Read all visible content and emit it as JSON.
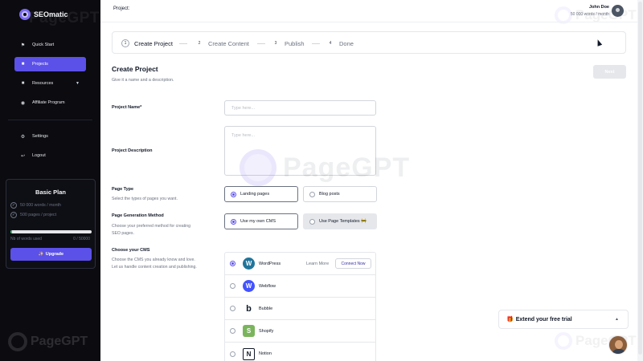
{
  "brand": {
    "name": "SEOmatic",
    "watermark": "PageGPT"
  },
  "sidebar": {
    "items": [
      {
        "label": "Quick Start",
        "icon": "flag-icon"
      },
      {
        "label": "Projects",
        "icon": "file-icon"
      },
      {
        "label": "Resources",
        "icon": "file-icon"
      },
      {
        "label": "Affiliate Program",
        "icon": "bullseye-icon"
      },
      {
        "label": "Settings",
        "icon": "gear-icon"
      },
      {
        "label": "Logout",
        "icon": "logout-icon"
      }
    ],
    "active_item": "Projects"
  },
  "plan": {
    "title": "Basic Plan",
    "features": [
      "50 000 words / month",
      "500 pages / project"
    ],
    "usage_label": "Nb of words used",
    "usage_value": "0 / 50000",
    "usage_fraction": 0.02,
    "upgrade_label": "Upgrade"
  },
  "header": {
    "project_label": "Project:",
    "user_name": "John Doe",
    "user_usage": "50 000 words / month"
  },
  "stepper": {
    "steps": [
      {
        "num": "1",
        "label": "Create Project",
        "active": true
      },
      {
        "num": "2",
        "label": "Create Content",
        "active": false
      },
      {
        "num": "3",
        "label": "Publish",
        "active": false
      },
      {
        "num": "4",
        "label": "Done",
        "active": false
      }
    ]
  },
  "form": {
    "title": "Create Project",
    "subtitle": "Give it a name and a description.",
    "next_label": "Next",
    "project_name_label": "Project Name*",
    "project_name_placeholder": "Type here...",
    "project_name_value": "",
    "project_description_label": "Project Description",
    "project_description_placeholder": "Type here...",
    "page_type": {
      "label": "Page Type",
      "help": "Select the types of pages you want.",
      "options": [
        "Landing pages",
        "Blog posts"
      ],
      "selected": "Landing pages"
    },
    "generation_method": {
      "label": "Page Generation Method",
      "help": "Choose your preferred method for creating SEO pages.",
      "options": [
        "Use my own CMS",
        "Use Page Templates 🚧"
      ],
      "selected": "Use my own CMS"
    },
    "cms": {
      "label": "Choose your CMS",
      "help": "Choose the CMS you already know and love. Let us handle content creation and publishing.",
      "selected": "WordPress",
      "learn_more_label": "Learn More",
      "connect_label": "Connect Now",
      "options": [
        {
          "name": "WordPress",
          "icon": "wordpress-icon",
          "glyph": "W",
          "color": "#21759b"
        },
        {
          "name": "Webflow",
          "icon": "webflow-icon",
          "glyph": "W",
          "color": "#4353ff"
        },
        {
          "name": "Bubble",
          "icon": "bubble-icon",
          "glyph": "b",
          "color": "#ffffff"
        },
        {
          "name": "Shopify",
          "icon": "shopify-icon",
          "glyph": "S",
          "color": "#7ab55c"
        },
        {
          "name": "Notion",
          "icon": "notion-icon",
          "glyph": "N",
          "color": "#ffffff"
        }
      ]
    }
  },
  "trial": {
    "emoji": "🎁",
    "label": "Extend your free trial"
  }
}
